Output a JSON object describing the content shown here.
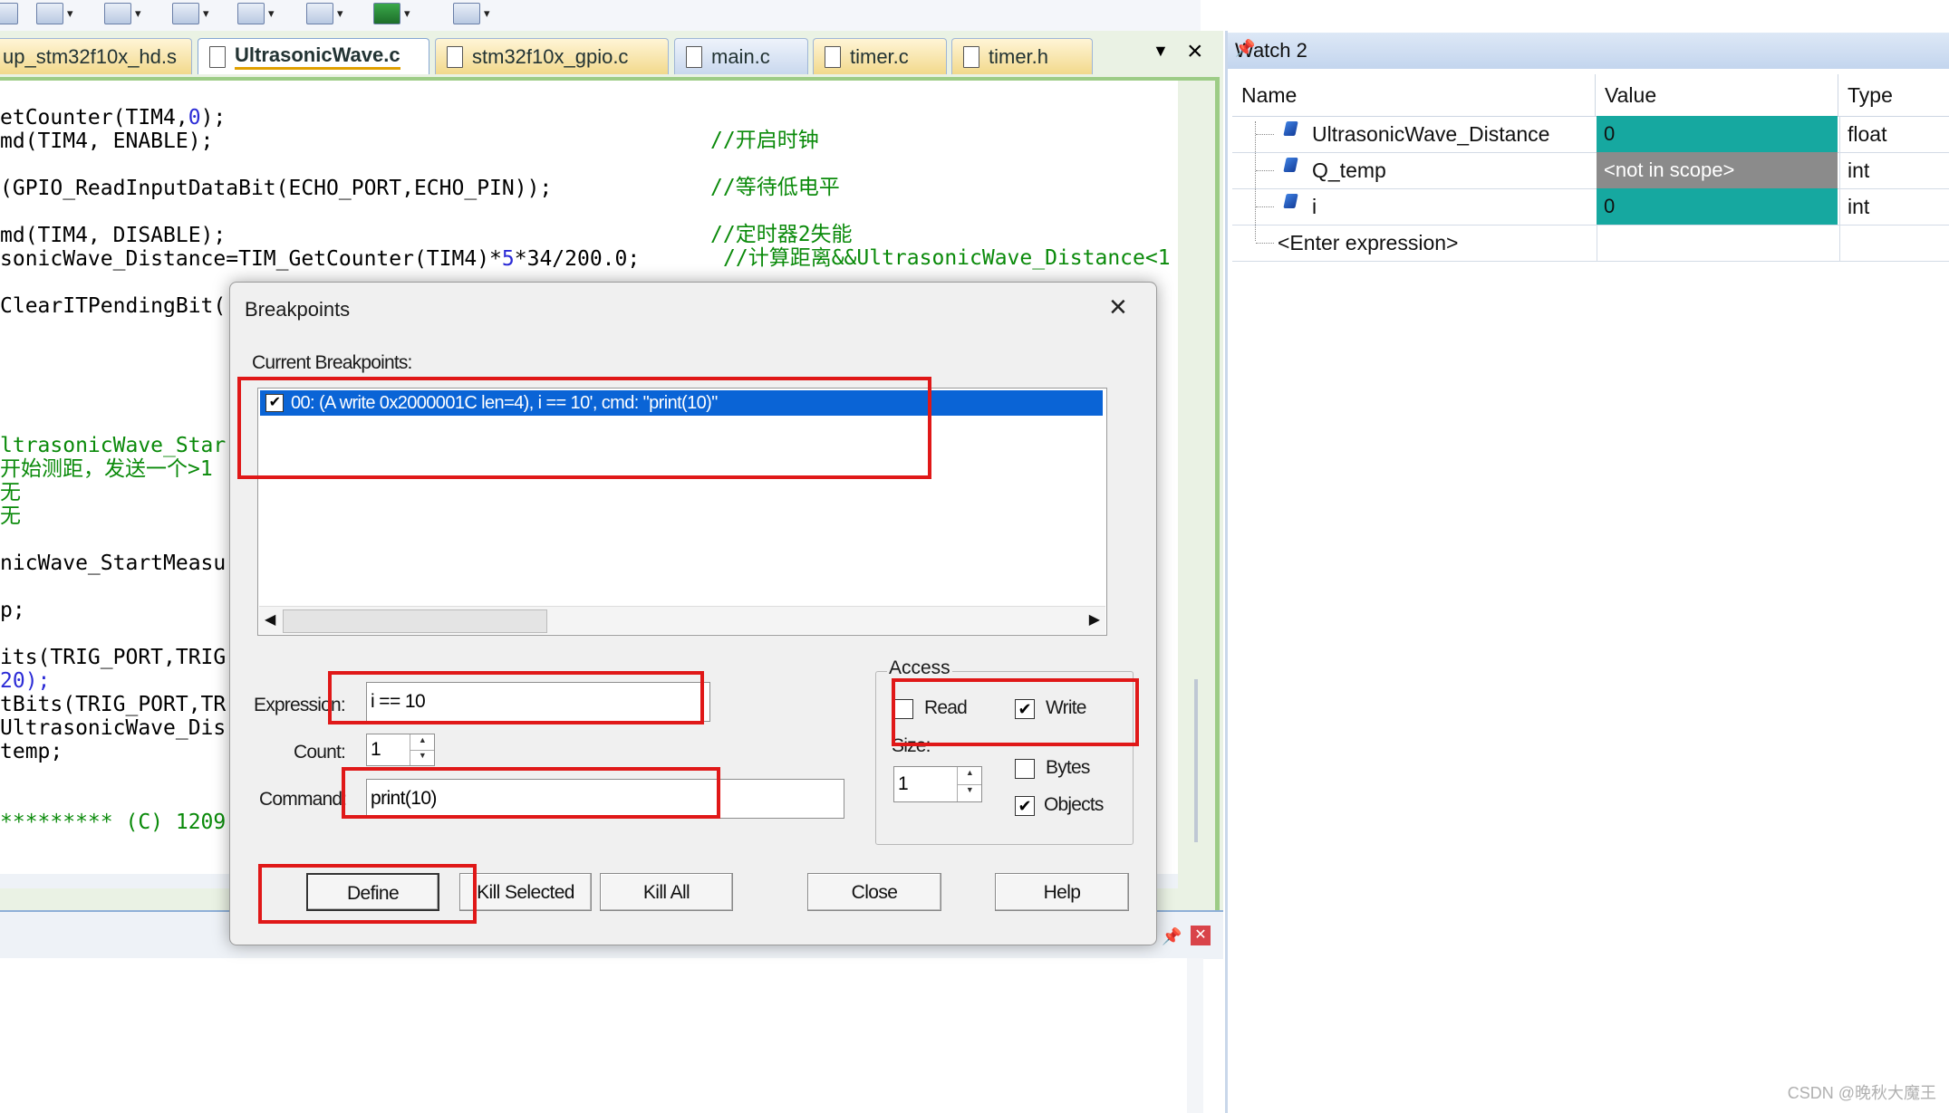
{
  "toolbar": {
    "icons": [
      "run-icon",
      "window-icon",
      "memory-icon",
      "trace-icon",
      "debug-icon",
      "toolbox-icon",
      "chip-icon",
      "tools-icon"
    ]
  },
  "tabs": [
    {
      "label": "up_stm32f10x_hd.s"
    },
    {
      "label": "UltrasonicWave.c"
    },
    {
      "label": "stm32f10x_gpio.c"
    },
    {
      "label": "main.c"
    },
    {
      "label": "timer.c"
    },
    {
      "label": "timer.h"
    }
  ],
  "code": {
    "lines": [
      {
        "code": "etCounter(TIM4,",
        "num": "0",
        "tail": ");",
        "comment": ""
      },
      {
        "code": "md(TIM4, ENABLE);",
        "num": "",
        "tail": "",
        "comment": "//开启时钟"
      },
      {
        "code": "(GPIO_ReadInputDataBit(ECHO_PORT,ECHO_PIN));",
        "num": "",
        "tail": "",
        "comment": "//等待低电平"
      },
      {
        "code": "md(TIM4, DISABLE);",
        "num": "",
        "tail": "",
        "comment": "//定时器2失能"
      },
      {
        "code": "sonicWave_Distance=TIM_GetCounter(TIM4)*",
        "num": "5",
        "tail": "*34/200.0;",
        "comment": "//计算距离&&UltrasonicWave_Distance<1"
      },
      {
        "code": "ClearITPendingBit(",
        "num": "",
        "tail": "",
        "comment": ""
      }
    ],
    "left_lines": [
      {
        "text": "ltrasonicWave_Star",
        "green": true
      },
      {
        "text": "开始测距，发送一个>1",
        "green": true
      },
      {
        "text": "无",
        "green": true
      },
      {
        "text": "无",
        "green": true
      },
      {
        "text": "nicWave_StartMeasu",
        "green": false
      },
      {
        "text": "p;",
        "green": false
      },
      {
        "text": "its(TRIG_PORT,TRIG",
        "green": false
      },
      {
        "text": "20);",
        "green": false,
        "blue": true
      },
      {
        "text": "tBits(TRIG_PORT,TR",
        "green": false
      },
      {
        "text": "UltrasonicWave_Dis",
        "green": false
      },
      {
        "text": "temp;",
        "green": false
      },
      {
        "text": "********* (C) 1209",
        "green": true
      }
    ]
  },
  "watch": {
    "title": "Watch 2",
    "columns": {
      "name": "Name",
      "value": "Value",
      "type": "Type"
    },
    "rows": [
      {
        "name": "UltrasonicWave_Distance",
        "value": "0",
        "type": "float",
        "style": "teal"
      },
      {
        "name": "Q_temp",
        "value": "<not in scope>",
        "type": "int",
        "style": "gray"
      },
      {
        "name": "i",
        "value": "0",
        "type": "int",
        "style": "teal"
      }
    ],
    "enter_expression": "<Enter expression>"
  },
  "dialog": {
    "title": "Breakpoints",
    "current_label": "Current Breakpoints:",
    "breakpoint_item": "00: (A write 0x2000001C len=4),  i == 10',  cmd: \"print(10)\"",
    "breakpoint_checked": true,
    "expression_label": "Expression:",
    "expression_value": "i == 10",
    "count_label": "Count:",
    "count_value": "1",
    "command_label": "Command:",
    "command_value": "print(10)",
    "access_label": "Access",
    "read_label": "Read",
    "read_checked": false,
    "write_label": "Write",
    "write_checked": true,
    "size_label": "Size:",
    "size_value": "1",
    "bytes_label": "Bytes",
    "bytes_checked": false,
    "objects_label": "Objects",
    "objects_checked": true,
    "buttons": {
      "define": "Define",
      "kill_selected": "Kill Selected",
      "kill_all": "Kill All",
      "close": "Close",
      "help": "Help"
    }
  },
  "watermark": "CSDN @晚秋大魔王",
  "accent_colors": {
    "highlight_red": "#e01818",
    "selection_blue": "#0a64d6",
    "watch_teal": "#16a8a0"
  }
}
